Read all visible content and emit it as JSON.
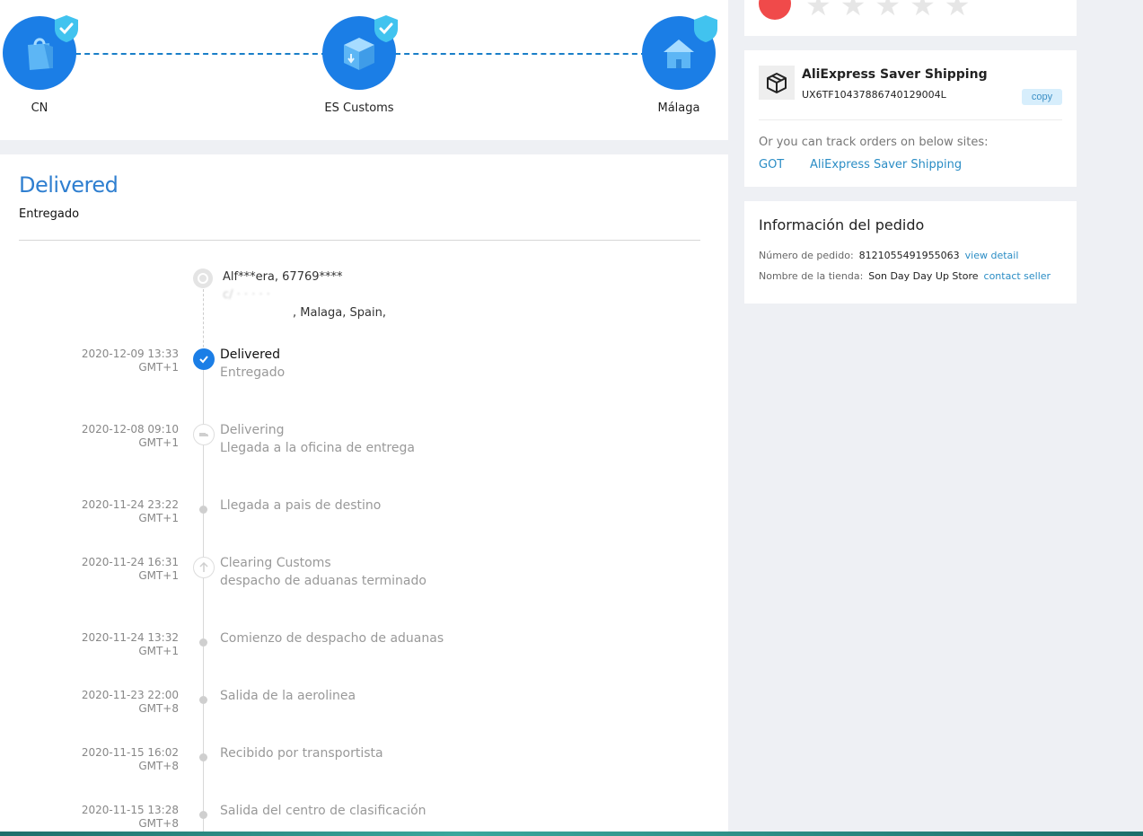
{
  "stages": [
    {
      "label": "CN",
      "icon": "shopping-bag-icon"
    },
    {
      "label": "ES Customs",
      "icon": "parcel-box-icon"
    },
    {
      "label": "Málaga",
      "icon": "house-icon"
    }
  ],
  "status": {
    "title": "Delivered",
    "subtitle": "Entregado"
  },
  "address": {
    "line1": "Alf***era,  67769****",
    "line2": "c/  ·  ·  ·  ·  ·",
    "line3": ",  Malaga,  Spain,"
  },
  "events": [
    {
      "date": "2020-12-09 13:33",
      "tz": "GMT+1",
      "primary": "Delivered",
      "secondary": "Entregado"
    },
    {
      "date": "2020-12-08 09:10",
      "tz": "GMT+1",
      "primary": "Delivering",
      "secondary": "Llegada a la oficina de entrega"
    },
    {
      "date": "2020-11-24 23:22",
      "tz": "GMT+1",
      "primary": "Llegada a pais de destino",
      "secondary": ""
    },
    {
      "date": "2020-11-24 16:31",
      "tz": "GMT+1",
      "primary": "Clearing Customs",
      "secondary": "despacho de aduanas terminado"
    },
    {
      "date": "2020-11-24 13:32",
      "tz": "GMT+1",
      "primary": "Comienzo de despacho de aduanas",
      "secondary": ""
    },
    {
      "date": "2020-11-23 22:00",
      "tz": "GMT+8",
      "primary": "Salida de la aerolinea",
      "secondary": ""
    },
    {
      "date": "2020-11-15 16:02",
      "tz": "GMT+8",
      "primary": "Recibido por transportista",
      "secondary": ""
    },
    {
      "date": "2020-11-15 13:28",
      "tz": "GMT+8",
      "primary": "Salida del centro de clasificación",
      "secondary": ""
    }
  ],
  "shipping": {
    "name": "AliExpress Saver Shipping",
    "tracking": "UX6TF10437886740129004L",
    "copy_label": "copy",
    "note": "Or you can track orders on below sites:",
    "links": [
      "GOT",
      "AliExpress Saver Shipping"
    ]
  },
  "order": {
    "title": "Información del pedido",
    "number_label": "Número de pedido:",
    "number_value": "8121055491955063",
    "view_detail": "view detail",
    "store_label": "Nombre de la tienda:",
    "store_value": "Son Day Day Up Store",
    "contact_seller": "contact seller"
  },
  "colors": {
    "accent": "#1b7ee6",
    "link": "#2b8dc5",
    "title_blue": "#2f7fd0"
  }
}
